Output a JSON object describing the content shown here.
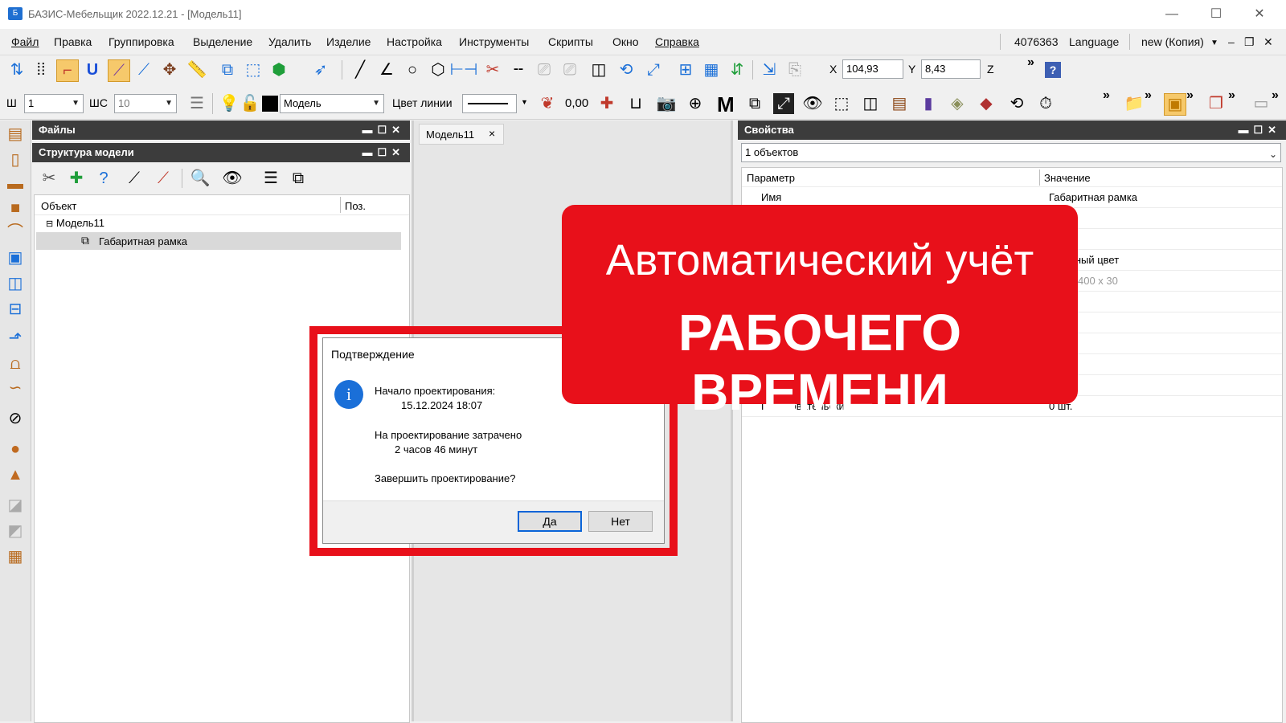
{
  "window": {
    "title": "БАЗИС-Мебельщик 2022.12.21 - [Модель11]",
    "icon": "app-logo-icon"
  },
  "menu": {
    "items": [
      "Файл",
      "Правка",
      "Группировка",
      "Выделение",
      "Удалить",
      "Изделие",
      "Настройка",
      "Инструменты",
      "Скрипты",
      "Окно",
      "Справка"
    ],
    "right": {
      "id": "4076363",
      "language": "Language",
      "profile": "new (Копия)"
    }
  },
  "toolbar1": {
    "x_label": "X",
    "x_value": "104,93",
    "y_label": "Y",
    "y_value": "8,43",
    "z_label": "Z"
  },
  "toolbar2": {
    "w_label": "Ш",
    "w_value": "1",
    "ws_label": "ШС",
    "ws_value": "10",
    "layer_value": "Модель",
    "line_color_label": "Цвет линии",
    "value": "0,00",
    "m_label": "M"
  },
  "files_panel": {
    "title": "Файлы"
  },
  "structure_panel": {
    "title": "Структура модели",
    "columns": [
      "Объект",
      "Поз."
    ],
    "tree": [
      {
        "label": "Модель11",
        "level": 0,
        "expanded": true
      },
      {
        "label": "Габаритная рамка",
        "level": 1,
        "selected": true
      }
    ]
  },
  "doc_tab": {
    "label": "Модель11",
    "close": "×"
  },
  "properties": {
    "title": "Свойства",
    "selector": "1 объектов",
    "columns": [
      "Параметр",
      "Значение"
    ],
    "rows": [
      {
        "param": "Имя",
        "value": "Габаритная рамка"
      },
      {
        "param": "",
        "value": ""
      },
      {
        "param": "",
        "value": ""
      },
      {
        "param": "",
        "value": "...данный цвет"
      },
      {
        "param": "",
        "value": "400 x 30"
      }
    ],
    "bottom_row": {
      "param": "Пользовательские",
      "value": "0 шт."
    }
  },
  "dialog": {
    "title": "Подтверждение",
    "start_label": "Начало проектирования:",
    "start_value": "15.12.2024 18:07",
    "spent_label": "На проектирование затрачено",
    "spent_value": "2 часов 46 минут",
    "question": "Завершить проектирование?",
    "yes": "Да",
    "no": "Нет"
  },
  "banner": {
    "line1": "Автоматический учёт",
    "line2": "РАБОЧЕГО ВРЕМЕНИ"
  },
  "colors": {
    "accent_red": "#e8101a",
    "panel_header": "#3c3c3c",
    "info_blue": "#1a6fd8"
  }
}
